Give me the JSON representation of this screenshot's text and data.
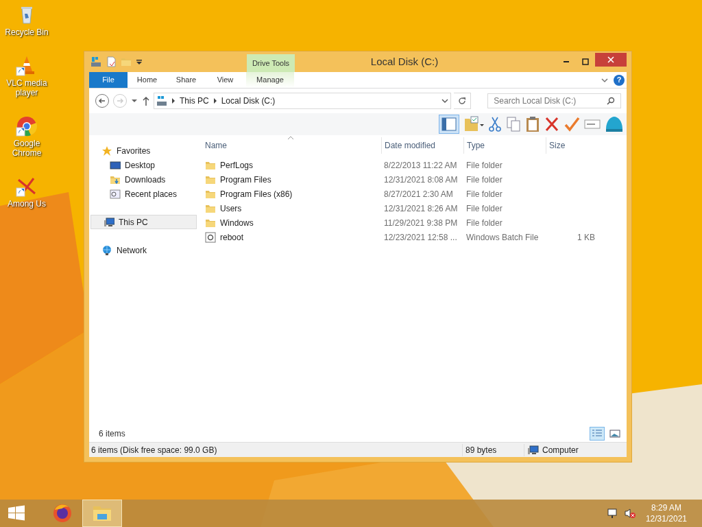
{
  "desktop_icons": [
    {
      "label": "Recycle Bin",
      "kind": "recycle",
      "shortcut": false
    },
    {
      "label": "VLC media player",
      "kind": "vlc",
      "shortcut": true
    },
    {
      "label": "Google Chrome",
      "kind": "chrome",
      "shortcut": true
    },
    {
      "label": "Among Us",
      "kind": "among",
      "shortcut": true
    }
  ],
  "window": {
    "title": "Local Disk (C:)",
    "context_group": "Drive Tools",
    "help_label": "?",
    "ribbon_tabs": [
      {
        "label": "File",
        "kind": "file",
        "selected": false
      },
      {
        "label": "Home",
        "kind": "normal",
        "selected": false
      },
      {
        "label": "Share",
        "kind": "normal",
        "selected": false
      },
      {
        "label": "View",
        "kind": "normal",
        "selected": false
      },
      {
        "label": "Manage",
        "kind": "contextual",
        "selected": false
      }
    ],
    "breadcrumbs": [
      "This PC",
      "Local Disk (C:)"
    ],
    "search": {
      "placeholder": "Search Local Disk (C:)"
    },
    "nav": [
      {
        "label": "Favorites",
        "kind": "star",
        "selected": false,
        "children": [
          {
            "label": "Desktop",
            "kind": "desktop",
            "selected": false
          },
          {
            "label": "Downloads",
            "kind": "downloads",
            "selected": false
          },
          {
            "label": "Recent places",
            "kind": "recent",
            "selected": false
          }
        ]
      },
      {
        "label": "This PC",
        "kind": "pc",
        "selected": true
      },
      {
        "label": "Network",
        "kind": "network",
        "selected": false
      }
    ],
    "columns": [
      "Name",
      "Date modified",
      "Type",
      "Size"
    ],
    "rows": [
      {
        "name": "PerfLogs",
        "date": "8/22/2013 11:22 AM",
        "type": "File folder",
        "kind": "folder"
      },
      {
        "name": "Program Files",
        "date": "12/31/2021 8:08 AM",
        "type": "File folder",
        "kind": "folder"
      },
      {
        "name": "Program Files (x86)",
        "date": "8/27/2021 2:30 AM",
        "type": "File folder",
        "kind": "folder"
      },
      {
        "name": "Users",
        "date": "12/31/2021 8:26 AM",
        "type": "File folder",
        "kind": "folder"
      },
      {
        "name": "Windows",
        "date": "11/29/2021 9:38 PM",
        "type": "File folder",
        "kind": "folder"
      },
      {
        "name": "reboot",
        "date": "12/23/2021 12:58 ...",
        "type": "Windows Batch File",
        "size": "1 KB",
        "kind": "batch"
      }
    ],
    "item_count": "6 items",
    "views": [
      {
        "kind": "details",
        "selected": true
      },
      {
        "kind": "large",
        "selected": false
      }
    ],
    "status_bar": {
      "summary": "6 items (Disk free space: 99.0 GB)",
      "size": "89 bytes",
      "zone": "Computer"
    }
  },
  "taskbar": {
    "apps": [
      {
        "kind": "firefox",
        "selected": false
      },
      {
        "kind": "explorer",
        "selected": true
      }
    ],
    "time": "8:29 AM",
    "date": "12/31/2021"
  }
}
